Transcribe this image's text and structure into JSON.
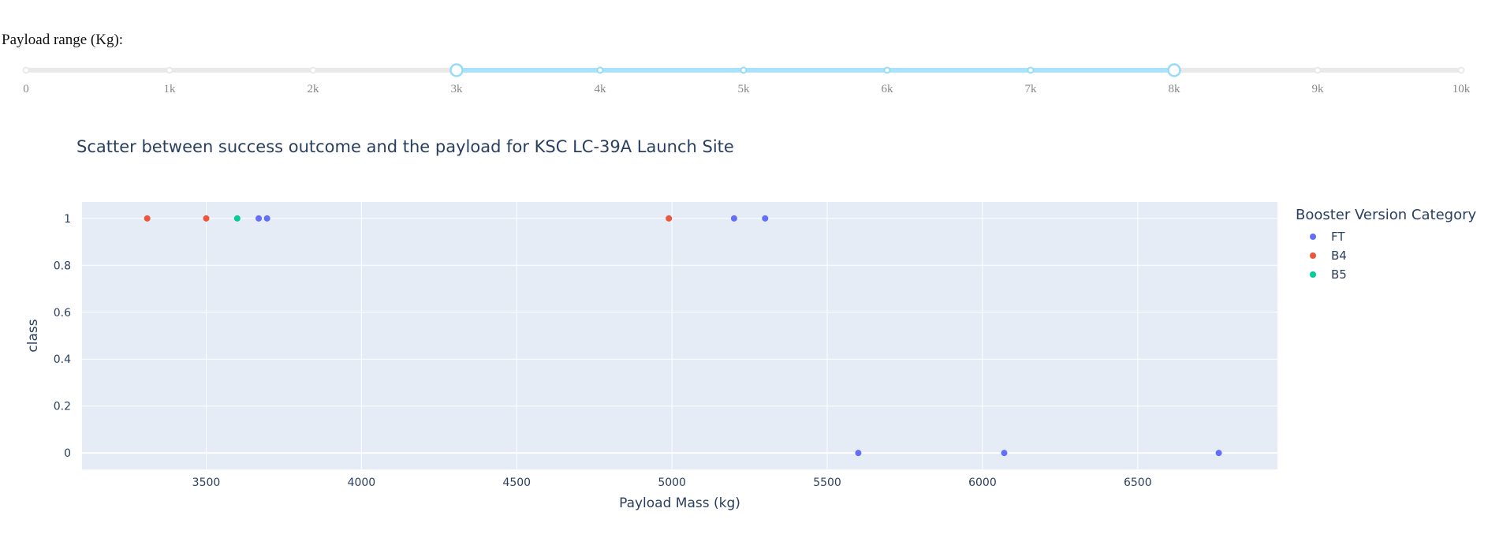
{
  "slider": {
    "label": "Payload range (Kg):",
    "min": 0,
    "max": 10000,
    "value": [
      3000,
      8000
    ],
    "marks": [
      {
        "value": 0,
        "label": "0"
      },
      {
        "value": 1000,
        "label": "1k"
      },
      {
        "value": 2000,
        "label": "2k"
      },
      {
        "value": 3000,
        "label": "3k"
      },
      {
        "value": 4000,
        "label": "4k"
      },
      {
        "value": 5000,
        "label": "5k"
      },
      {
        "value": 6000,
        "label": "6k"
      },
      {
        "value": 7000,
        "label": "7k"
      },
      {
        "value": 8000,
        "label": "8k"
      },
      {
        "value": 9000,
        "label": "9k"
      },
      {
        "value": 10000,
        "label": "10k"
      }
    ],
    "colors": {
      "track": "#e9e9e9",
      "active": "#abe2fb",
      "handle": "#96dbfa",
      "dot_inactive": "#e9e9e9"
    }
  },
  "chart_data": {
    "type": "scatter",
    "title": "Scatter between success outcome and the payload for KSC LC-39A Launch Site",
    "xlabel": "Payload Mass (kg)",
    "ylabel": "class",
    "xlim": [
      3100,
      6950
    ],
    "ylim": [
      -0.07,
      1.07
    ],
    "xticks": [
      3500,
      4000,
      4500,
      5000,
      5500,
      6000,
      6500
    ],
    "yticks": [
      0,
      0.2,
      0.4,
      0.6,
      0.8,
      1
    ],
    "ytick_labels": [
      "0",
      "0.2",
      "0.4",
      "0.6",
      "0.8",
      "1"
    ],
    "grid": true,
    "legend": {
      "title": "Booster Version Category",
      "position": "right"
    },
    "series": [
      {
        "name": "FT",
        "color": "#636efa",
        "x": [
          3669,
          3696,
          5200,
          5300,
          5600,
          6070,
          6761
        ],
        "y": [
          1,
          1,
          1,
          1,
          0,
          0,
          0
        ]
      },
      {
        "name": "B4",
        "color": "#ef553b",
        "x": [
          3310,
          3500,
          4990
        ],
        "y": [
          1,
          1,
          1
        ]
      },
      {
        "name": "B5",
        "color": "#00cc96",
        "x": [
          3600
        ],
        "y": [
          1
        ]
      }
    ]
  },
  "colors": {
    "plot_bg": "#e5ecf6",
    "grid": "#ffffff",
    "text": "#2a3f5f"
  }
}
